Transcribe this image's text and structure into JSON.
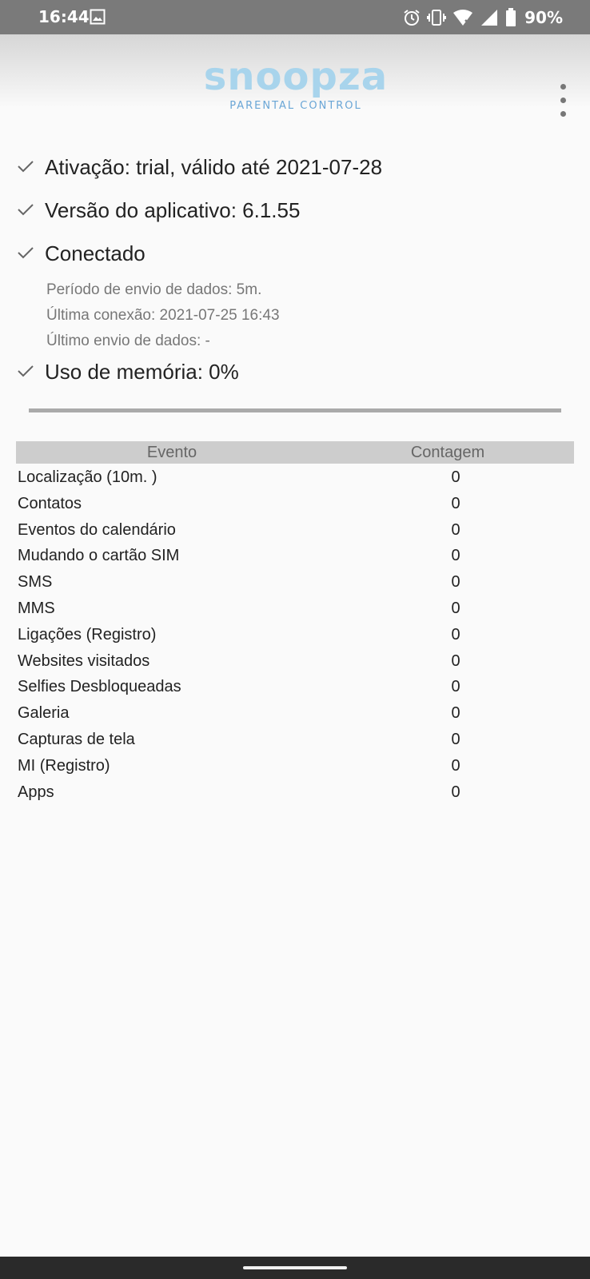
{
  "status_bar": {
    "time": "16:44",
    "battery": "90%",
    "icons": [
      "image-icon",
      "alarm-icon",
      "vibrate-icon",
      "wifi-icon",
      "signal-icon",
      "battery-icon"
    ]
  },
  "app": {
    "logo_text": "snoopza",
    "logo_subtitle": "PARENTAL CONTROL",
    "brand_color": "#a8d4ec"
  },
  "status": {
    "activation": "Ativação: trial, válido até 2021-07-28",
    "version": "Versão do aplicativo: 6.1.55",
    "connected": "Conectado",
    "details": {
      "send_period": "Período de envio de dados: 5m.",
      "last_connection": "Última conexão: 2021-07-25 16:43",
      "last_send": "Último envio de dados: -"
    },
    "memory": "Uso de memória: 0%"
  },
  "events": {
    "header": {
      "event": "Evento",
      "count": "Contagem"
    },
    "rows": [
      {
        "name": "Localização (10m. )",
        "count": "0"
      },
      {
        "name": "Contatos",
        "count": "0"
      },
      {
        "name": "Eventos do calendário",
        "count": "0"
      },
      {
        "name": "Mudando o cartão SIM",
        "count": "0"
      },
      {
        "name": "SMS",
        "count": "0"
      },
      {
        "name": "MMS",
        "count": "0"
      },
      {
        "name": "Ligações (Registro)",
        "count": "0"
      },
      {
        "name": "Websites visitados",
        "count": "0"
      },
      {
        "name": "Selfies Desbloqueadas",
        "count": "0"
      },
      {
        "name": "Galeria",
        "count": "0"
      },
      {
        "name": "Capturas de tela",
        "count": "0"
      },
      {
        "name": "MI (Registro)",
        "count": "0"
      },
      {
        "name": "Apps",
        "count": "0"
      }
    ]
  }
}
